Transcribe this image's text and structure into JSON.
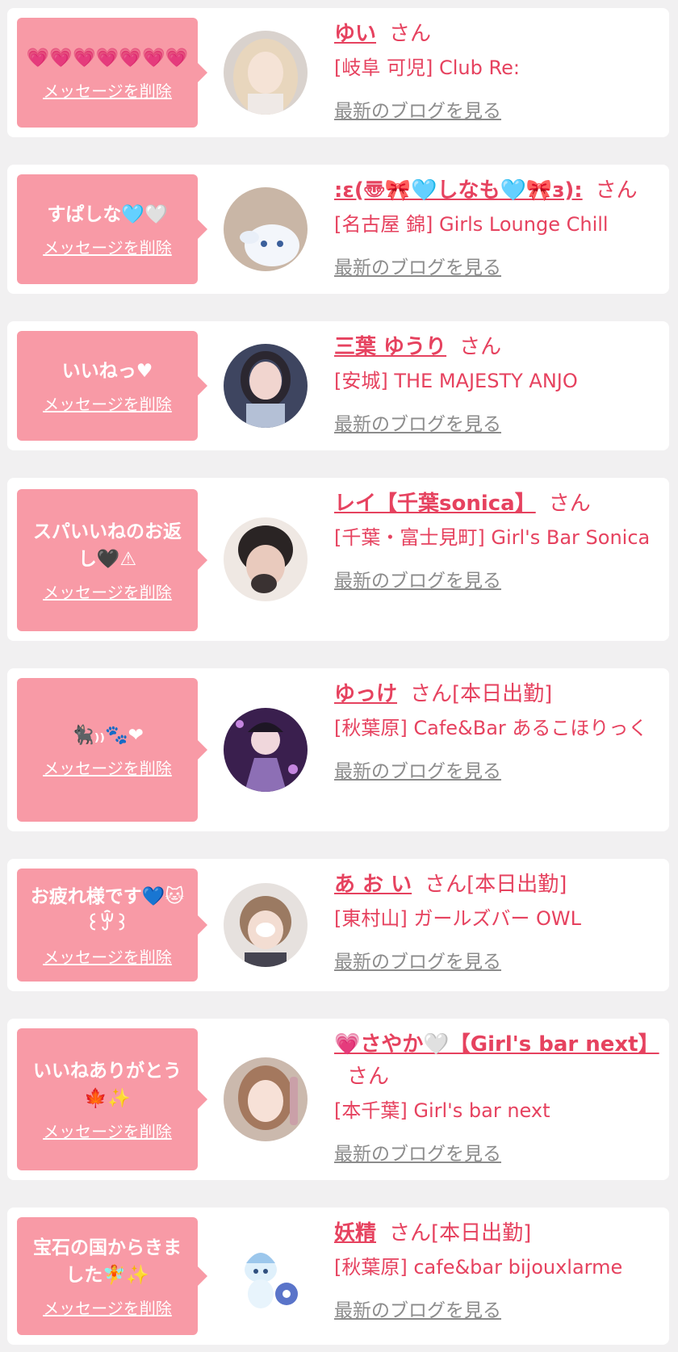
{
  "delete_label": "メッセージを削除",
  "blog_label": "最新のブログを見る",
  "colors": {
    "page_bg": "#f1f0f1",
    "card_bg": "#ffffff",
    "bubble_bg": "#f89aa6",
    "accent_pink": "#e6425f",
    "link_gray": "#8c8c8c"
  },
  "items": [
    {
      "message": "💗💗💗💗💗💗💗",
      "name": "ゆい",
      "honorific": "さん",
      "status": "",
      "shop": "[岐阜 可児] Club Re:"
    },
    {
      "message": "すぱしな🩵🤍",
      "name": ":ε(〠🎀🩵しなも🩵🎀з):",
      "honorific": "さん",
      "status": "",
      "shop": "[名古屋 錦] Girls Lounge Chill"
    },
    {
      "message": "いいねっ♥",
      "name": "三葉 ゆうり",
      "honorific": "さん",
      "status": "",
      "shop": "[安城] THE MAJESTY ANJO"
    },
    {
      "message": "スパいいねのお返し🖤⚠",
      "name": "レイ【千葉sonica】",
      "honorific": "さん",
      "status": "",
      "shop": "[千葉・富士見町] Girl's Bar Sonica"
    },
    {
      "message": "🐈‍⬛₎₎🐾❤",
      "name": "ゆっけ",
      "honorific": "さん",
      "status": "[本日出勤]",
      "shop": "[秋葉原] Cafe&Bar あるこほりっく"
    },
    {
      "message": "お疲れ様です💙🐱꒰ꏭ꒱",
      "name": "あ お い",
      "honorific": "さん",
      "status": "[本日出勤]",
      "shop": "[東村山] ガールズバー OWL"
    },
    {
      "message": "いいねありがとう🍁✨",
      "name": "💗さやか🤍【Girl's bar next】",
      "honorific": "さん",
      "status": "",
      "shop": "[本千葉] Girl's bar next"
    },
    {
      "message": "宝石の国からきました🧚✨",
      "name": "妖精",
      "honorific": "さん",
      "status": "[本日出勤]",
      "shop": "[秋葉原] cafe&bar bijouxlarme"
    }
  ]
}
